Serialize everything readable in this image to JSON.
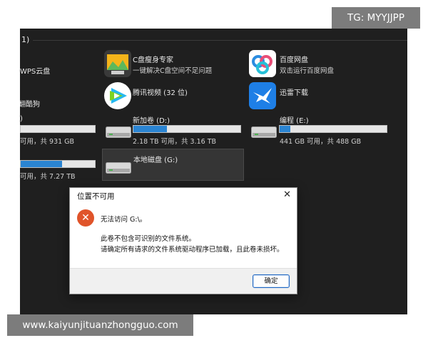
{
  "watermark": {
    "top_right": "TG: MYYJJPP",
    "bottom_left": "www.kaiyunjituanzhongguo.com"
  },
  "explorer": {
    "section_header_fragment": "1)",
    "left_items": {
      "wps_label": "WPS云盘",
      "sougou_label": "翻酷狗",
      "drive_left1_label": ")",
      "drive_left1_size": "可用，共 931 GB",
      "drive_left2_size": "可用，共 7.27 TB"
    },
    "apps": [
      {
        "name": "C盘瘦身专家",
        "desc": "一键解决C盘空间不足问题"
      },
      {
        "name": "百度网盘",
        "desc": "双击运行百度网盘"
      },
      {
        "name": "腾讯视频 (32 位)"
      },
      {
        "name": "迅雷下载"
      }
    ],
    "drives": [
      {
        "name": "新加卷 (D:)",
        "size": "2.18 TB 可用，共 3.16 TB",
        "used": 0.31
      },
      {
        "name": "编程 (E:)",
        "size": "441 GB 可用，共 488 GB",
        "used": 0.1
      },
      {
        "name": "本地磁盘 (G:)"
      }
    ],
    "left_bar_used": [
      0,
      0.56
    ]
  },
  "dialog": {
    "title": "位置不可用",
    "close_glyph": "✕",
    "error_glyph": "✕",
    "line1": "无法访问 G:\\。",
    "line2": "此卷不包含可识别的文件系统。",
    "line3": "请确定所有请求的文件系统驱动程序已加载，且此卷未损坏。",
    "ok_label": "确定"
  },
  "colors": {
    "bar_fill": "#2a84d2",
    "error_red": "#e0542a",
    "screen_bg": "#1f1f1f"
  }
}
